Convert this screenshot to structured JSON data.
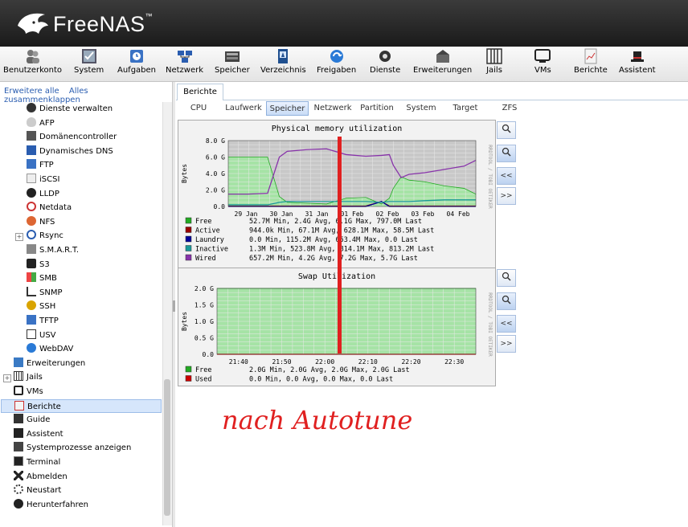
{
  "app": {
    "name": "FreeNAS",
    "colors": {
      "header": "#2a2a2a",
      "accent": "#2a5db0",
      "chart_bg": "#c8c8c8",
      "annotation": "#e02020"
    }
  },
  "toolbar": {
    "items": [
      {
        "label": "Benutzerkonto",
        "icon": "users-icon"
      },
      {
        "label": "System",
        "icon": "system-icon"
      },
      {
        "label": "Aufgaben",
        "icon": "tasks-icon"
      },
      {
        "label": "Netzwerk",
        "icon": "network-icon"
      },
      {
        "label": "Speicher",
        "icon": "storage-icon"
      },
      {
        "label": "Verzeichnis",
        "icon": "directory-icon"
      },
      {
        "label": "Freigaben",
        "icon": "sharing-icon"
      },
      {
        "label": "Dienste",
        "icon": "services-icon"
      },
      {
        "label": "Erweiterungen",
        "icon": "plugins-icon"
      },
      {
        "label": "Jails",
        "icon": "jails-icon"
      },
      {
        "label": "VMs",
        "icon": "vms-icon"
      },
      {
        "label": "Berichte",
        "icon": "reports-icon"
      },
      {
        "label": "Assistent",
        "icon": "wizard-icon"
      }
    ]
  },
  "sidebar": {
    "expand_all": "Erweitere alle",
    "collapse_all": "Alles zusammenklappen",
    "items": [
      {
        "label": "Dienste verwalten",
        "icon": "gear-icon"
      },
      {
        "label": "AFP",
        "icon": "apple-icon"
      },
      {
        "label": "Domänencontroller",
        "icon": "domain-controller-icon"
      },
      {
        "label": "Dynamisches DNS",
        "icon": "dns-icon"
      },
      {
        "label": "FTP",
        "icon": "ftp-icon"
      },
      {
        "label": "iSCSI",
        "icon": "iscsi-icon"
      },
      {
        "label": "LLDP",
        "icon": "lldp-icon"
      },
      {
        "label": "Netdata",
        "icon": "netdata-icon"
      },
      {
        "label": "NFS",
        "icon": "nfs-icon"
      },
      {
        "label": "Rsync",
        "icon": "rsync-icon"
      },
      {
        "label": "S.M.A.R.T.",
        "icon": "smart-icon"
      },
      {
        "label": "S3",
        "icon": "s3-icon"
      },
      {
        "label": "SMB",
        "icon": "windows-icon"
      },
      {
        "label": "SNMP",
        "icon": "snmp-icon"
      },
      {
        "label": "SSH",
        "icon": "ssh-icon"
      },
      {
        "label": "TFTP",
        "icon": "tftp-icon"
      },
      {
        "label": "USV",
        "icon": "ups-icon"
      },
      {
        "label": "WebDAV",
        "icon": "webdav-icon"
      },
      {
        "label": "Erweiterungen",
        "icon": "plugins-icon"
      },
      {
        "label": "Jails",
        "icon": "jails-icon"
      },
      {
        "label": "VMs",
        "icon": "vms-icon"
      },
      {
        "label": "Berichte",
        "icon": "reports-icon"
      },
      {
        "label": "Guide",
        "icon": "guide-icon"
      },
      {
        "label": "Assistent",
        "icon": "wizard-icon"
      },
      {
        "label": "Systemprozesse anzeigen",
        "icon": "processes-icon"
      },
      {
        "label": "Terminal",
        "icon": "terminal-icon"
      },
      {
        "label": "Abmelden",
        "icon": "logout-icon"
      },
      {
        "label": "Neustart",
        "icon": "reboot-icon"
      },
      {
        "label": "Herunterfahren",
        "icon": "shutdown-icon"
      }
    ]
  },
  "main": {
    "tab": "Berichte",
    "subtabs": [
      "CPU",
      "Laufwerk",
      "Speicher",
      "Netzwerk",
      "Partition",
      "System",
      "Target",
      "ZFS"
    ],
    "active_subtab": "Speicher",
    "side_buttons": [
      "zoom-in-icon",
      "zoom-out-icon",
      "<<",
      ">>"
    ],
    "rrd_watermark": "RRDTOOL / TOBI OETIKER"
  },
  "chart_data": [
    {
      "type": "area",
      "title": "Physical memory utilization",
      "ylabel": "Bytes",
      "ylim": [
        0,
        8
      ],
      "yticks": [
        "0.0",
        "2.0 G",
        "4.0 G",
        "6.0 G",
        "8.0 G"
      ],
      "xticks": [
        "29 Jan",
        "30 Jan",
        "31 Jan",
        "01 Feb",
        "02 Feb",
        "03 Feb",
        "04 Feb"
      ],
      "grid": true,
      "x": [
        0,
        0.5,
        1,
        1.3,
        1.5,
        2,
        2.5,
        3,
        3.5,
        3.9,
        4.1,
        4.2,
        4.4,
        4.6,
        5,
        5.5,
        6,
        6.3
      ],
      "series": [
        {
          "name": "Free",
          "color": "#22aa22",
          "stats": "52.7M Min,     2.4G Avg,     6.1G Max,   797.0M Last",
          "values": [
            6.0,
            6.0,
            6.0,
            1.2,
            0.5,
            0.4,
            0.3,
            1.0,
            1.1,
            0.3,
            1.0,
            2.2,
            3.6,
            3.2,
            3.0,
            2.5,
            2.2,
            1.5
          ]
        },
        {
          "name": "Active",
          "color": "#990000",
          "stats": "944.0k Min,    67.1M Avg,   628.1M Max,    58.5M Last",
          "values": [
            0.05,
            0.05,
            0.05,
            0.05,
            0.05,
            0.05,
            0.05,
            0.05,
            0.05,
            0.6,
            0.05,
            0.05,
            0.05,
            0.05,
            0.05,
            0.05,
            0.05,
            0.05
          ]
        },
        {
          "name": "Laundry",
          "color": "#000099",
          "stats": "0.0  Min,   115.2M Avg,   653.4M Max,     0.0  Last",
          "values": [
            0,
            0,
            0,
            0,
            0,
            0,
            0,
            0,
            0,
            0.6,
            0,
            0,
            0,
            0,
            0,
            0,
            0,
            0
          ]
        },
        {
          "name": "Inactive",
          "color": "#1a9999",
          "stats": "1.3M Min,   523.8M Avg,   814.1M Max,   813.2M Last",
          "values": [
            0.2,
            0.2,
            0.2,
            0.5,
            0.6,
            0.6,
            0.6,
            0.6,
            0.6,
            0.5,
            0.6,
            0.6,
            0.6,
            0.6,
            0.7,
            0.8,
            0.8,
            0.8
          ]
        },
        {
          "name": "Wired",
          "color": "#8833aa",
          "stats": "657.2M Min,     4.2G Avg,     7.2G Max,     5.7G Last",
          "values": [
            1.5,
            1.5,
            1.6,
            6.0,
            6.7,
            6.9,
            7.0,
            6.3,
            6.1,
            6.2,
            6.3,
            5.0,
            3.5,
            3.9,
            4.1,
            4.5,
            4.9,
            5.6
          ]
        }
      ]
    },
    {
      "type": "area",
      "title": "Swap Utilization",
      "ylabel": "Bytes",
      "ylim": [
        0,
        2
      ],
      "yticks": [
        "0.0",
        "0.5 G",
        "1.0 G",
        "1.5 G",
        "2.0 G"
      ],
      "xticks": [
        "21:40",
        "21:50",
        "22:00",
        "22:10",
        "22:20",
        "22:30"
      ],
      "grid": true,
      "series": [
        {
          "name": "Free",
          "color": "#22aa22",
          "stats": "2.0G Min,     2.0G Avg,     2.0G Max,     2.0G Last",
          "values": [
            2.0,
            2.0
          ]
        },
        {
          "name": "Used",
          "color": "#cc0000",
          "stats": "0.0  Min,     0.0  Avg,     0.0  Max,     0.0  Last",
          "values": [
            0.0,
            0.0
          ]
        }
      ]
    }
  ],
  "annotation": {
    "text": "nach Autotune",
    "color": "#e02020"
  }
}
